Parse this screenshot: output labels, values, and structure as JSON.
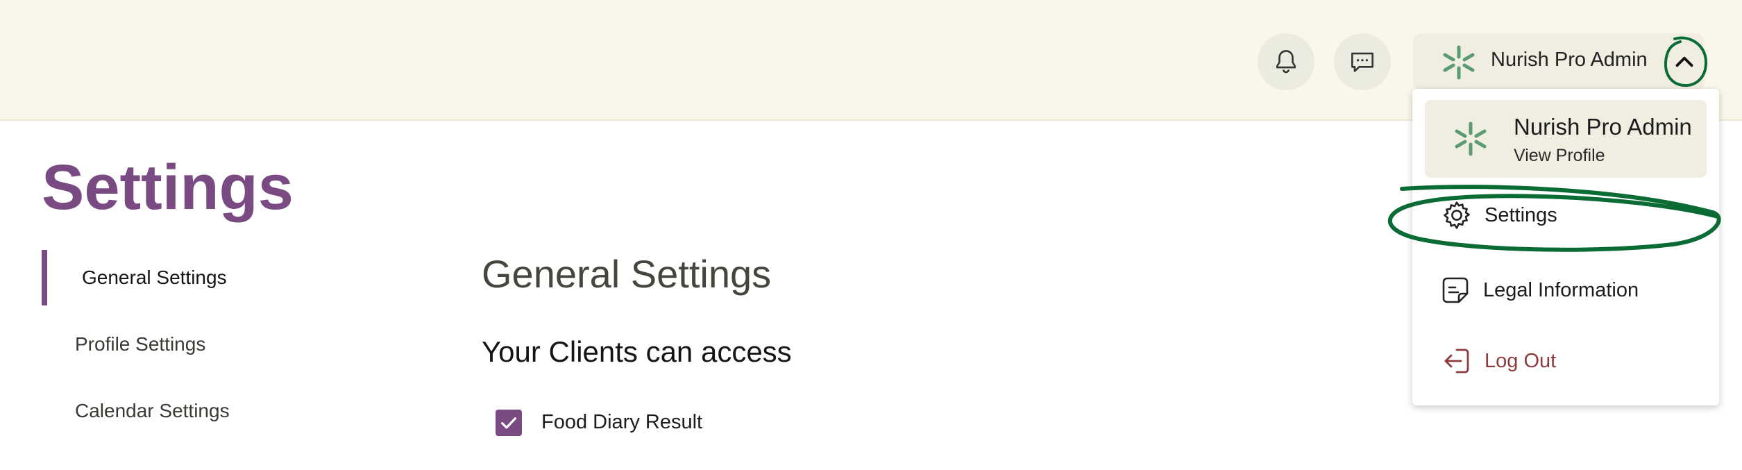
{
  "header": {
    "user_name": "Nurish Pro Admin",
    "icons": [
      "bell-icon",
      "chat-icon",
      "chevron-up-icon"
    ]
  },
  "page": {
    "title": "Settings"
  },
  "nav": {
    "items": [
      {
        "label": "General Settings",
        "active": true
      },
      {
        "label": "Profile Settings",
        "active": false
      },
      {
        "label": "Calendar Settings",
        "active": false
      }
    ]
  },
  "main": {
    "section_title": "General Settings",
    "subtitle": "Your Clients can access",
    "options": [
      {
        "label": "Food Diary Result",
        "checked": true
      }
    ]
  },
  "dropdown": {
    "profile_name": "Nurish Pro Admin",
    "profile_link": "View Profile",
    "items": [
      {
        "label": "Settings",
        "icon": "gear-icon"
      },
      {
        "label": "Legal Information",
        "icon": "document-icon"
      },
      {
        "label": "Log Out",
        "icon": "logout-icon"
      }
    ]
  },
  "colors": {
    "brand_purple": "#7a4b83",
    "topbar_bg": "#f9f7ea",
    "annotation_green": "#0b6b35",
    "logout_red": "#8c3c3c"
  }
}
